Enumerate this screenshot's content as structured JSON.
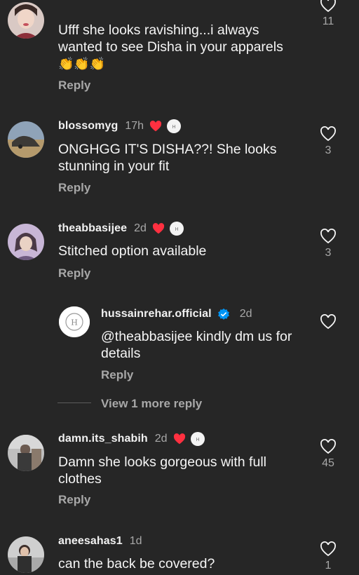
{
  "comments": [
    {
      "username": "",
      "time": "",
      "text_lines": [
        "Ufff she looks ravishing...i always",
        "wanted to see Disha in your apparels"
      ],
      "emoji": "👏👏👏",
      "reply_label": "Reply",
      "likes": "11"
    },
    {
      "username": "blossomyg",
      "time": "17h",
      "text_lines": [
        "ONGHGG IT'S DISHA??! She looks",
        "stunning in your fit"
      ],
      "reply_label": "Reply",
      "likes": "3"
    },
    {
      "username": "theabbasijee",
      "time": "2d",
      "text_lines": [
        "Stitched option available"
      ],
      "reply_label": "Reply",
      "likes": "3"
    },
    {
      "username": "hussainrehar.official",
      "time": "2d",
      "text_lines": [
        "@theabbasijee kindly dm us for",
        "details"
      ],
      "reply_label": "Reply",
      "likes": ""
    },
    {
      "username": "damn.its_shabih",
      "time": "2d",
      "text_lines": [
        "Damn she looks gorgeous with full",
        "clothes"
      ],
      "reply_label": "Reply",
      "likes": "45"
    },
    {
      "username": "aneesahas1",
      "time": "1d",
      "text_lines": [
        "can the back be covered?"
      ],
      "likes": "1"
    }
  ],
  "view_more_replies": "View 1 more reply",
  "icons": {
    "like": "heart-outline-icon",
    "creator_liked": "heart-filled-icon",
    "verified": "verified-badge-icon"
  },
  "colors": {
    "background": "#262626",
    "heart_red": "#ff3040",
    "verified_blue": "#0095f6",
    "secondary_text": "#a8a8a8"
  }
}
